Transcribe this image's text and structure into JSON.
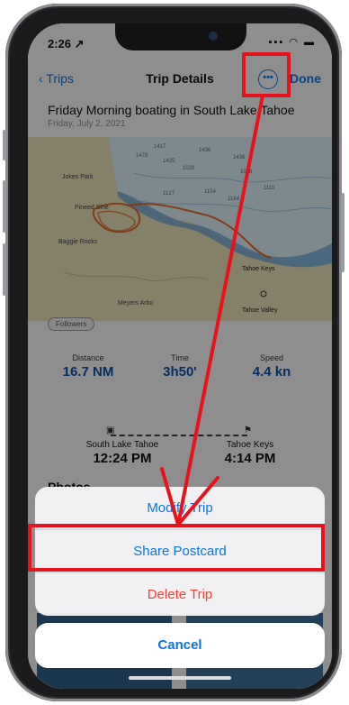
{
  "status": {
    "time": "2:26 ↗",
    "icons": "▪▪▪ ◠ ▬"
  },
  "nav": {
    "back_label": "‹ Trips",
    "title": "Trip Details",
    "more_icon": "•••",
    "done_label": "Done"
  },
  "trip": {
    "title": "Friday Morning boating in South Lake Tahoe",
    "date": "Friday, July 2, 2021"
  },
  "map": {
    "labels": [
      "Jokes Park",
      "Pineed Sine",
      "Tahoe Keys",
      "Tahoe Valley",
      "Meyers Arbo",
      "Baggie Rocks"
    ],
    "depths": [
      "1417",
      "1436",
      "1436",
      "1425",
      "1478",
      "1020",
      "1048",
      "1154",
      "1127",
      "1184",
      "1110"
    ]
  },
  "followers_badge": "Followers",
  "stats": [
    {
      "label": "Distance",
      "value": "16.7 NM"
    },
    {
      "label": "Time",
      "value": "3h50'"
    },
    {
      "label": "Speed",
      "value": "4.4 kn"
    }
  ],
  "route": {
    "start": {
      "name": "South Lake Tahoe",
      "time": "12:24 PM"
    },
    "end": {
      "name": "Tahoe Keys",
      "time": "4:14 PM"
    }
  },
  "photos_label": "Photos",
  "action_sheet": {
    "modify": "Modify Trip",
    "share": "Share Postcard",
    "delete": "Delete Trip",
    "cancel": "Cancel"
  },
  "colors": {
    "accent": "#0a74e8",
    "destructive": "#ff3b30",
    "annotation": "#e8121b",
    "stat_value": "#0b4fa8"
  }
}
